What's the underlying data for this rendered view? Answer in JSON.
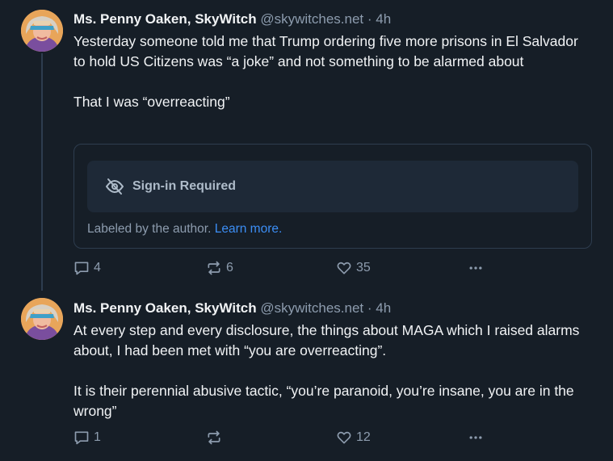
{
  "posts": [
    {
      "author": "Ms. Penny Oaken, SkyWitch",
      "handle": "@skywitches.net",
      "separator": "·",
      "time": "4h",
      "paragraphs": [
        "Yesterday someone told me that Trump ordering five more prisons in El Salvador to hold US Citizens was “a joke” and not something to be alarmed about",
        "That I was “overreacting”"
      ],
      "label_card": {
        "notice": "Sign-in Required",
        "labeled_by": "Labeled by the author.",
        "learn_more": "Learn more."
      },
      "counts": {
        "replies": "4",
        "reposts": "6",
        "likes": "35"
      }
    },
    {
      "author": "Ms. Penny Oaken, SkyWitch",
      "handle": "@skywitches.net",
      "separator": "·",
      "time": "4h",
      "paragraphs": [
        "At every step and every disclosure, the things about MAGA which I raised alarms about, I had been met with “you are overreacting”.",
        "It is their perennial abusive tactic, “you’re paranoid, you’re insane, you are in the wrong”"
      ],
      "counts": {
        "replies": "1",
        "reposts": "",
        "likes": "12"
      }
    }
  ],
  "icons": {
    "reply": "speech-bubble-icon",
    "repost": "repost-arrows-icon",
    "like": "heart-icon",
    "more": "ellipsis-icon",
    "hidden": "eye-slash-icon"
  },
  "colors": {
    "background": "#161e27",
    "text": "#f1f3f5",
    "muted": "#8d9cae",
    "link": "#3c8ef5",
    "card_border": "#2e3d4f",
    "notice_bg": "#1e2937"
  }
}
